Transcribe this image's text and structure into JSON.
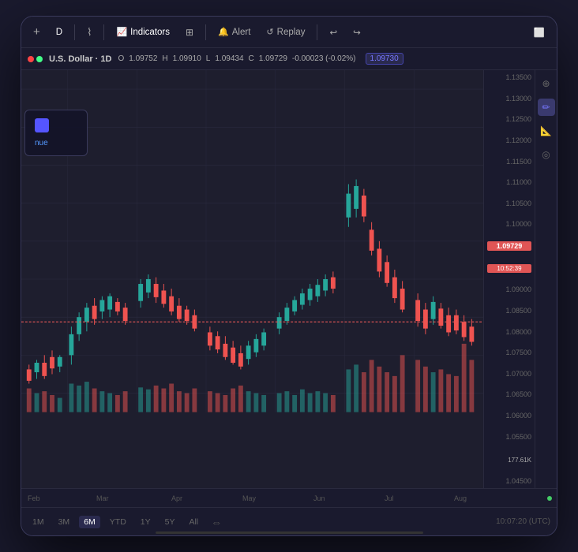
{
  "toolbar": {
    "interval_label": "D",
    "indicators_label": "Indicators",
    "alert_label": "Alert",
    "replay_label": "Replay",
    "undo_label": "↩",
    "redo_label": "↪",
    "expand_label": "⬜"
  },
  "symbol_bar": {
    "symbol": "U.S. Dollar · 1D",
    "interval": "1D",
    "open_label": "O",
    "open_val": "1.09752",
    "high_label": "H",
    "high_val": "1.09910",
    "low_label": "L",
    "low_val": "1.09434",
    "close_label": "C",
    "close_val": "1.09729",
    "change": "-0.00023 (-0.02%)",
    "current_price": "1.09730"
  },
  "price_scale": {
    "levels": [
      "1.13500",
      "1.13000",
      "1.12500",
      "1.12000",
      "1.11500",
      "1.11000",
      "1.10500",
      "1.10000",
      "1.09729",
      "1.09000",
      "1.08500",
      "1.08000",
      "1.07500",
      "1.07000",
      "1.06500",
      "1.06000",
      "1.05500",
      "1.04500"
    ],
    "current": "1.09729",
    "current_time": "10:52:39",
    "volume_label": "177.61K"
  },
  "time_axis": {
    "labels": [
      "Feb",
      "Mar",
      "Apr",
      "May",
      "Jun",
      "Jul",
      "Aug"
    ]
  },
  "bottom_bar": {
    "timeframes": [
      "1M",
      "3M",
      "6M",
      "YTD",
      "1Y",
      "5Y",
      "All"
    ],
    "active_timeframe": "6M",
    "time_display": "10:07:20 (UTC)"
  },
  "tooltip": {
    "text": "nue"
  },
  "sidebar_tools": [
    {
      "icon": "⊕",
      "name": "crosshair"
    },
    {
      "icon": "✏",
      "name": "pencil"
    },
    {
      "icon": "📐",
      "name": "ruler"
    },
    {
      "icon": "⊙",
      "name": "circle"
    }
  ],
  "colors": {
    "bg": "#1a1a2e",
    "toolbar_bg": "#1a1a2e",
    "up_candle": "#26a69a",
    "down_candle": "#ef5350",
    "price_line": "#e05555",
    "accent": "#5555ff",
    "grid": "#2a2a3e"
  }
}
